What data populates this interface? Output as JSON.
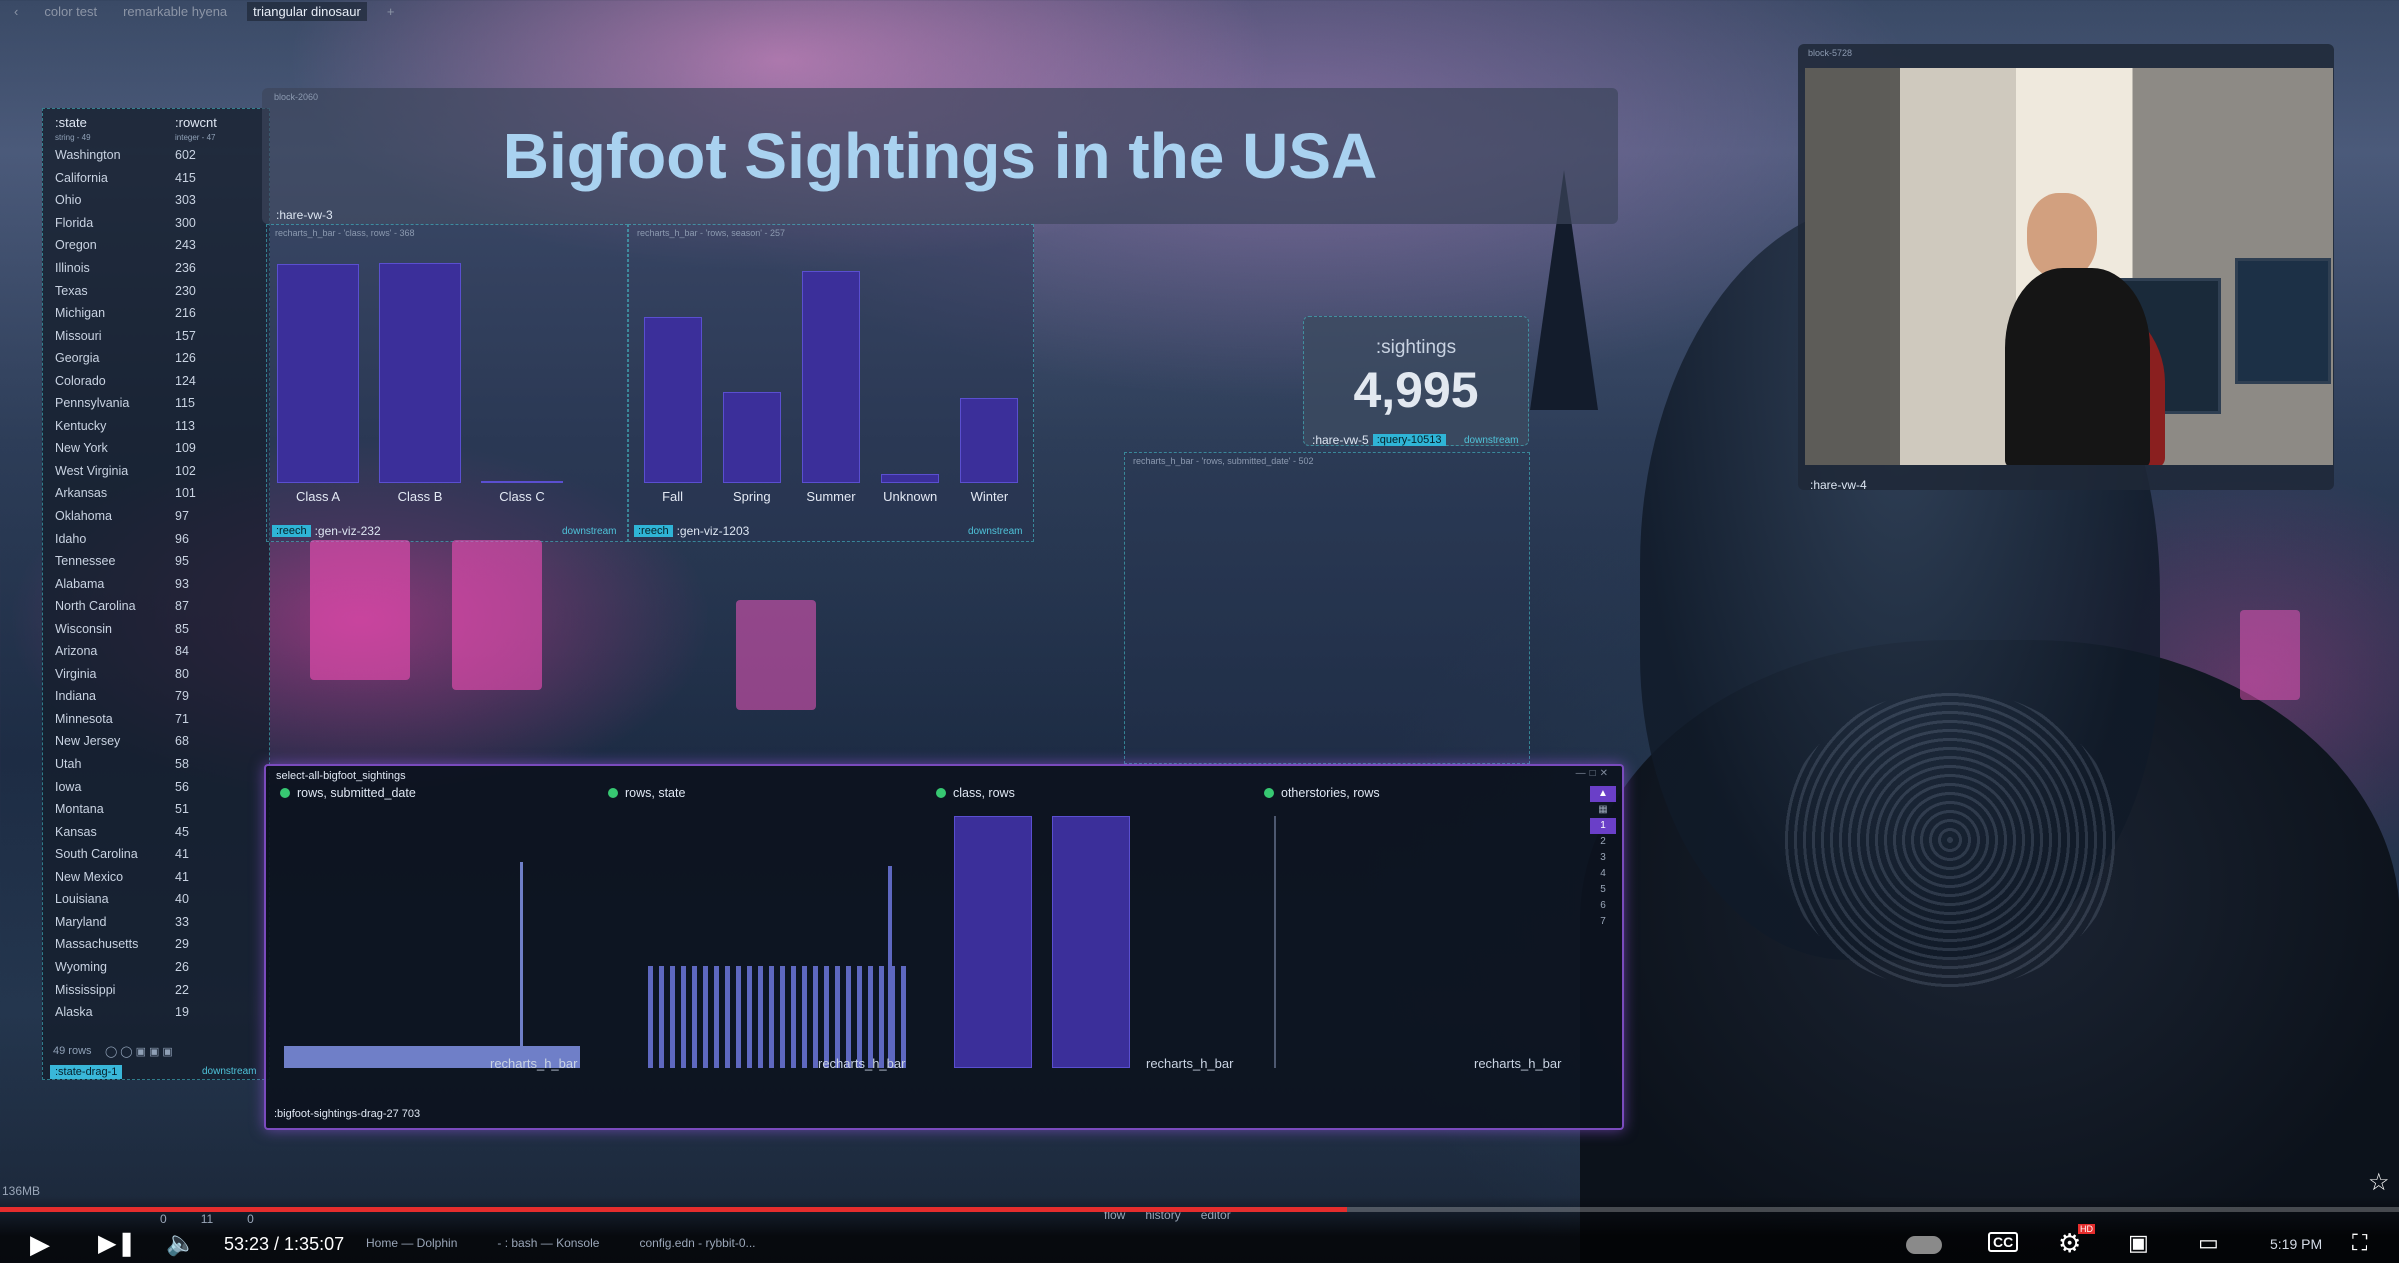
{
  "tabs": [
    "color test",
    "remarkable hyena",
    "triangular dinosaur"
  ],
  "active_tab_index": 2,
  "add_tab": "+",
  "title": "Bigfoot Sightings in the USA",
  "title_block": "block-2060",
  "state_table": {
    "columns": [
      ":state",
      ":rowcnt"
    ],
    "subheaders": [
      "string - 49",
      "integer - 47"
    ],
    "rows": [
      [
        "Washington",
        602
      ],
      [
        "California",
        415
      ],
      [
        "Ohio",
        303
      ],
      [
        "Florida",
        300
      ],
      [
        "Oregon",
        243
      ],
      [
        "Illinois",
        236
      ],
      [
        "Texas",
        230
      ],
      [
        "Michigan",
        216
      ],
      [
        "Missouri",
        157
      ],
      [
        "Georgia",
        126
      ],
      [
        "Colorado",
        124
      ],
      [
        "Pennsylvania",
        115
      ],
      [
        "Kentucky",
        113
      ],
      [
        "New York",
        109
      ],
      [
        "West Virginia",
        102
      ],
      [
        "Arkansas",
        101
      ],
      [
        "Oklahoma",
        97
      ],
      [
        "Idaho",
        96
      ],
      [
        "Tennessee",
        95
      ],
      [
        "Alabama",
        93
      ],
      [
        "North Carolina",
        87
      ],
      [
        "Wisconsin",
        85
      ],
      [
        "Arizona",
        84
      ],
      [
        "Virginia",
        80
      ],
      [
        "Indiana",
        79
      ],
      [
        "Minnesota",
        71
      ],
      [
        "New Jersey",
        68
      ],
      [
        "Utah",
        58
      ],
      [
        "Iowa",
        56
      ],
      [
        "Montana",
        51
      ],
      [
        "Kansas",
        45
      ],
      [
        "South Carolina",
        41
      ],
      [
        "New Mexico",
        41
      ],
      [
        "Louisiana",
        40
      ],
      [
        "Maryland",
        33
      ],
      [
        "Massachusetts",
        29
      ],
      [
        "Wyoming",
        26
      ],
      [
        "Mississippi",
        22
      ],
      [
        "Alaska",
        19
      ]
    ],
    "row_count": "49 rows",
    "chip": ":state-drag-1",
    "downstream": "downstream"
  },
  "hare_vw_3": ":hare-vw-3",
  "class_chart": {
    "header": "recharts_h_bar - 'class, rows' - 368",
    "chip": ":reech",
    "name": ":gen-viz-232",
    "downstream": "downstream"
  },
  "season_chart": {
    "header": "recharts_h_bar - 'rows, season' - 257",
    "chip": ":reech",
    "name": ":gen-viz-1203",
    "downstream": "downstream"
  },
  "chart_data": [
    {
      "type": "bar",
      "categories": [
        "Class A",
        "Class B",
        "Class C"
      ],
      "values": [
        2481,
        2495,
        19
      ],
      "title": "",
      "xlabel": "",
      "ylabel": ""
    },
    {
      "type": "bar",
      "categories": [
        "Fall",
        "Spring",
        "Summer",
        "Unknown",
        "Winter"
      ],
      "values": [
        1020,
        560,
        1300,
        55,
        520
      ],
      "title": "",
      "xlabel": "",
      "ylabel": ""
    }
  ],
  "sightings": {
    "label": ":sightings",
    "value": "4,995",
    "name": ":hare-vw-5",
    "chip": ":query-10513",
    "downstream": "downstream"
  },
  "submitted_date_header": "recharts_h_bar - 'rows, submitted_date' - 502",
  "webcam": {
    "block": "block-5728",
    "name": ":hare-vw-4"
  },
  "select_panel": {
    "title": "select-all-bigfoot_sightings",
    "footer": ":bigfoot-sightings-drag-27 703",
    "subcharts": [
      {
        "label": "rows, submitted_date",
        "bar_label": "recharts_h_bar"
      },
      {
        "label": "rows, state",
        "bar_label": "recharts_h_bar"
      },
      {
        "label": "class, rows",
        "bar_label": "recharts_h_bar"
      },
      {
        "label": "otherstories, rows",
        "bar_label": "recharts_h_bar"
      }
    ],
    "row_numbers": [
      "1",
      "2",
      "3",
      "4",
      "5",
      "6",
      "7"
    ]
  },
  "memory": "136MB",
  "player": {
    "time": "53:23 / 1:35:07",
    "progress_fraction": 0.5615,
    "taskbar": [
      "Home — Dolphin",
      "- : bash — Konsole",
      "config.edn - rybbit-0..."
    ],
    "menus": [
      "flow",
      "history",
      "editor"
    ],
    "counters": [
      "0",
      "11",
      "0"
    ],
    "clock": "5:19 PM",
    "hd": "HD"
  }
}
